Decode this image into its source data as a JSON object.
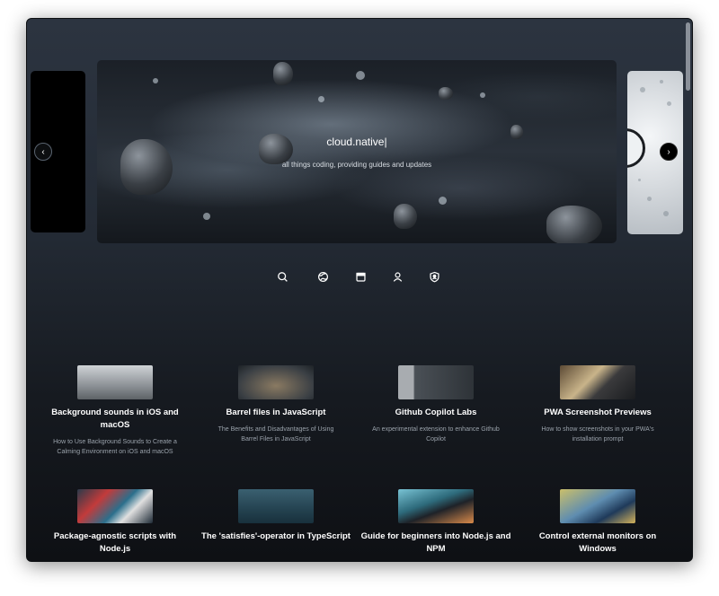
{
  "hero": {
    "title": "cloud.native|",
    "subtitle": "all things coding, providing guides and updates"
  },
  "carousel": {
    "prev_icon": "chevron-left-icon",
    "next_icon": "chevron-right-icon",
    "prev_glyph": "‹",
    "next_glyph": "›"
  },
  "iconbar": {
    "items": [
      {
        "icon": "search-icon"
      },
      {
        "icon": "globe-icon"
      },
      {
        "icon": "calendar-icon"
      },
      {
        "icon": "user-icon"
      },
      {
        "icon": "shield-user-icon"
      }
    ]
  },
  "posts": [
    {
      "title": "Background sounds in iOS and macOS",
      "description": "How to Use Background Sounds to Create a Calming Environment on iOS and macOS"
    },
    {
      "title": "Barrel files in JavaScript",
      "description": "The Benefits and Disadvantages of Using Barrel Files in JavaScript"
    },
    {
      "title": "Github Copilot Labs",
      "description": "An experimental extension to enhance Github Copilot"
    },
    {
      "title": "PWA Screenshot Previews",
      "description": "How to show screenshots in your PWA's installation prompt"
    },
    {
      "title": "Package-agnostic scripts with Node.js",
      "description": ""
    },
    {
      "title": "The 'satisfies'-operator in TypeScript",
      "description": ""
    },
    {
      "title": "Guide for beginners into Node.js and NPM",
      "description": ""
    },
    {
      "title": "Control external monitors on Windows",
      "description": ""
    }
  ]
}
